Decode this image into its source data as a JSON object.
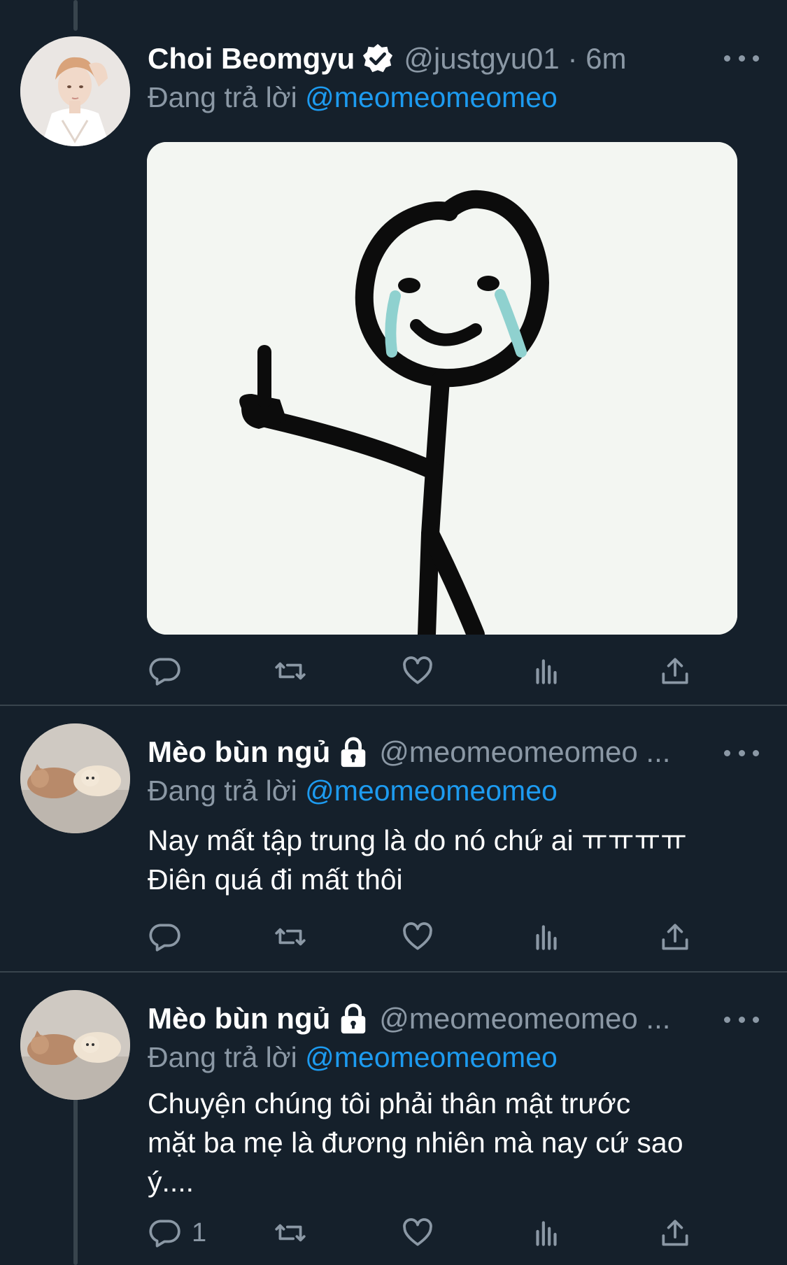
{
  "tweets": [
    {
      "display_name": "Choi Beomgyu",
      "handle": "@justgyu01 · 6m",
      "verified": true,
      "reply_prefix": "Đang trả lời",
      "reply_to": "@meomeomeomeo",
      "text_lines": [],
      "has_media": true,
      "reply_count": ""
    },
    {
      "display_name": "Mèo bùn ngủ",
      "handle": "@meomeomeomeo ...",
      "locked": true,
      "reply_prefix": "Đang trả lời",
      "reply_to": "@meomeomeomeo",
      "text_lines": [
        "Nay mất tập trung là do nó chứ ai ㅠㅠㅠㅠ",
        "Điên quá đi mất thôi"
      ],
      "has_media": false,
      "reply_count": ""
    },
    {
      "display_name": "Mèo bùn ngủ",
      "handle": "@meomeomeomeo ...",
      "locked": true,
      "reply_prefix": "Đang trả lời",
      "reply_to": "@meomeomeomeo",
      "text_lines": [
        "Chuyện chúng tôi phải thân mật trước",
        "mặt ba mẹ là đương nhiên mà nay cứ sao",
        "ý...."
      ],
      "has_media": false,
      "reply_count": "1"
    }
  ],
  "icons": {
    "verified": "verified-badge-icon",
    "lock": "lock-icon",
    "more": "more-icon",
    "reply": "reply-icon",
    "retweet": "retweet-icon",
    "like": "like-icon",
    "views": "views-icon",
    "share": "share-icon"
  },
  "colors": {
    "background": "#15202b",
    "divider": "#38444d",
    "secondary_text": "#8b98a5",
    "link": "#1d9bf0"
  }
}
